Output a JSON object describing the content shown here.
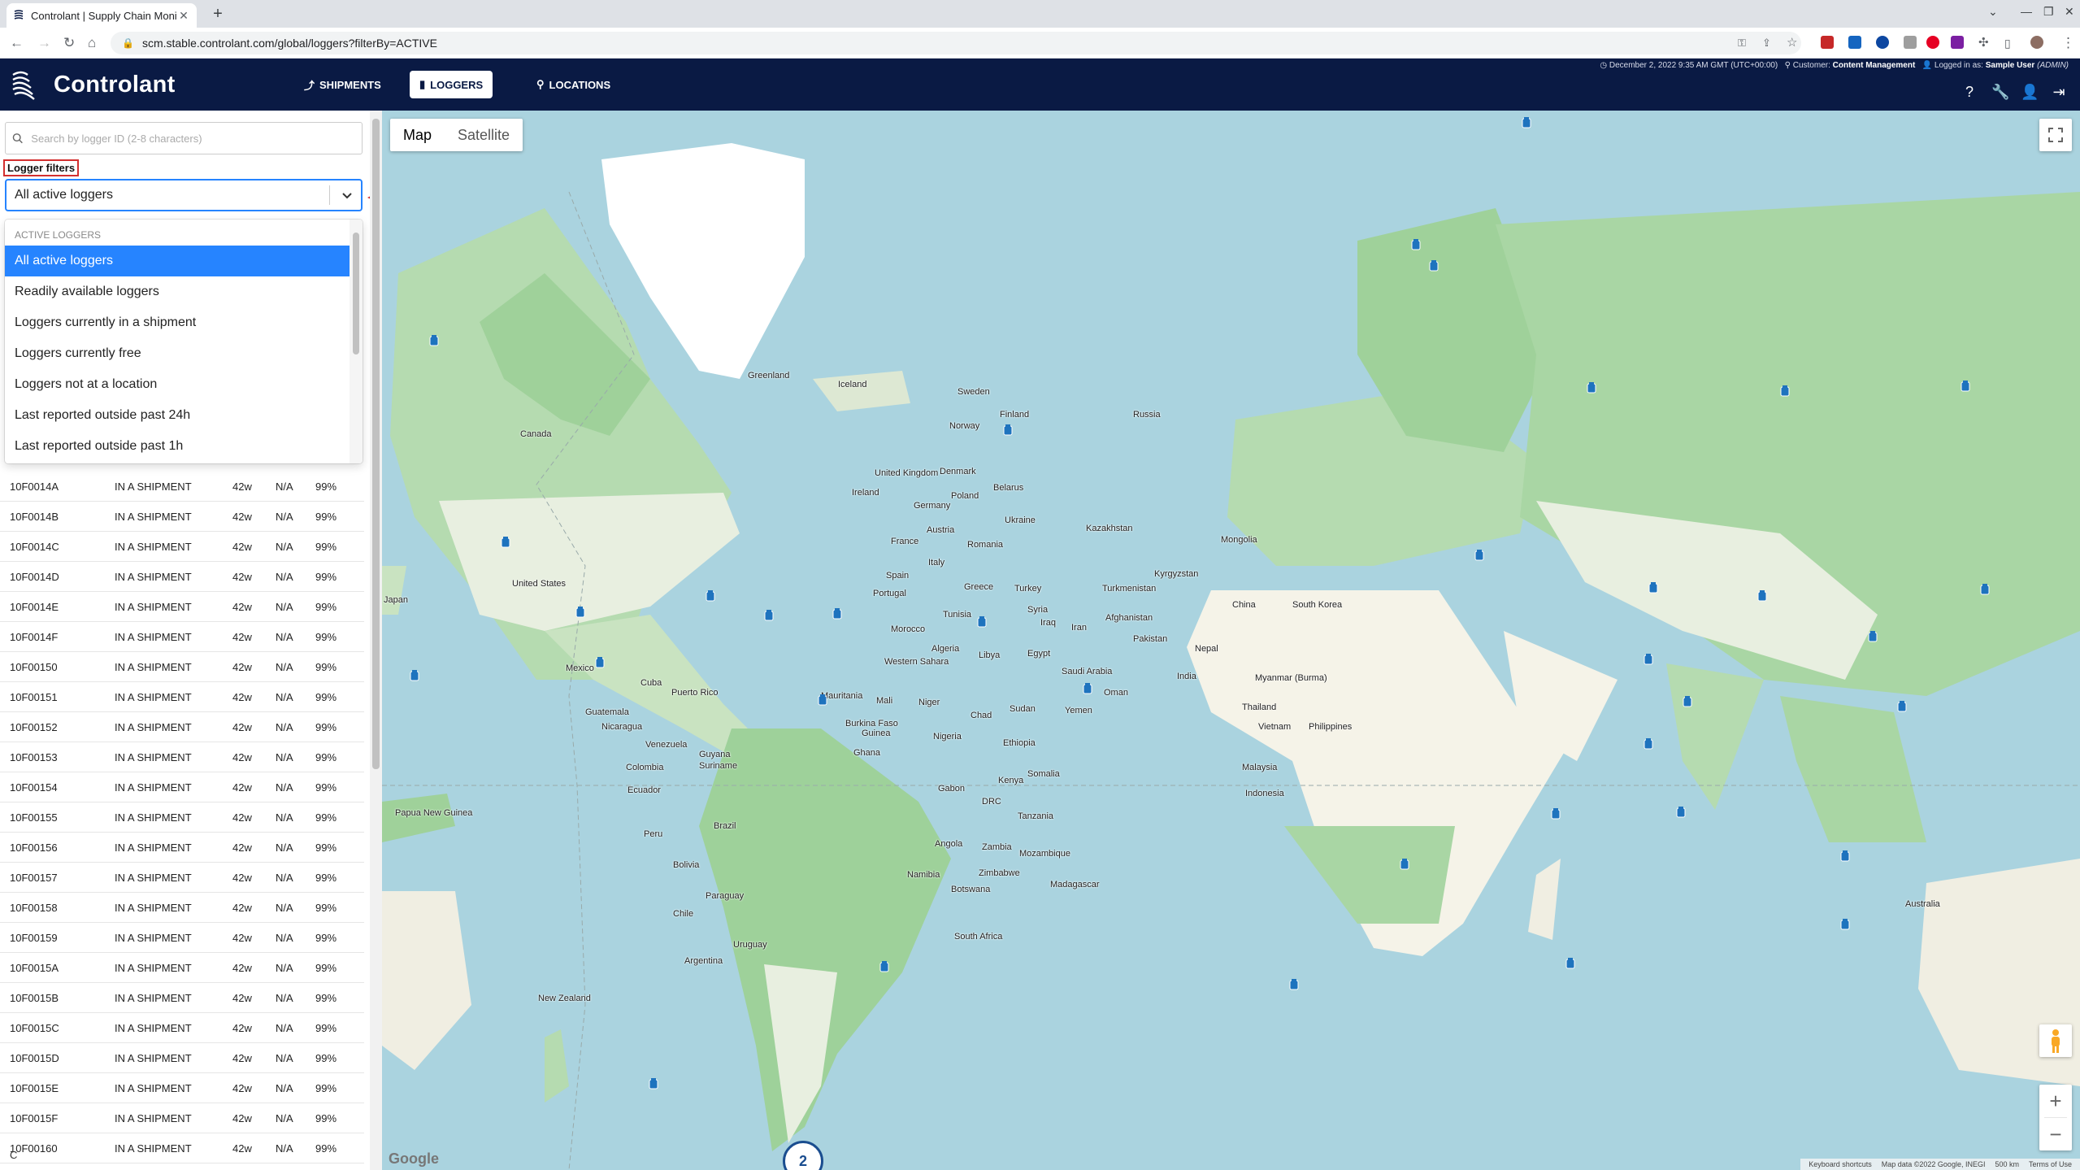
{
  "browser": {
    "tab_title": "Controlant | Supply Chain Monit...",
    "tab_close": "✕",
    "new_tab": "+",
    "url": "scm.stable.controlant.com/global/loggers?filterBy=ACTIVE",
    "window_controls": [
      "⌄",
      "—",
      "❐",
      "✕"
    ]
  },
  "app": {
    "brand": "Controlant",
    "nav": [
      {
        "label": "SHIPMENTS",
        "icon": "route-icon"
      },
      {
        "label": "LOGGERS",
        "icon": "logger-icon"
      },
      {
        "label": "LOCATIONS",
        "icon": "location-pin-icon"
      }
    ],
    "status": {
      "datetime": "December 2, 2022 9:35 AM GMT (UTC+00:00)",
      "customer_label": "Customer:",
      "customer": "Content Management",
      "logged_in_label": "Logged in as:",
      "user": "Sample User",
      "role": "(ADMIN)"
    }
  },
  "sidebar": {
    "search_placeholder": "Search by logger ID (2-8 characters)",
    "filter_label": "Logger filters",
    "selected_filter": "All active loggers",
    "dropdown_group": "ACTIVE LOGGERS",
    "options": [
      "All active loggers",
      "Readily available loggers",
      "Loggers currently in a shipment",
      "Loggers currently free",
      "Loggers not at a location",
      "Last reported outside past 24h",
      "Last reported outside past 1h"
    ],
    "rows": [
      {
        "id": "10F0014A",
        "status": "IN A SHIPMENT",
        "age": "42w",
        "na": "N/A",
        "battery": "99%"
      },
      {
        "id": "10F0014B",
        "status": "IN A SHIPMENT",
        "age": "42w",
        "na": "N/A",
        "battery": "99%"
      },
      {
        "id": "10F0014C",
        "status": "IN A SHIPMENT",
        "age": "42w",
        "na": "N/A",
        "battery": "99%"
      },
      {
        "id": "10F0014D",
        "status": "IN A SHIPMENT",
        "age": "42w",
        "na": "N/A",
        "battery": "99%"
      },
      {
        "id": "10F0014E",
        "status": "IN A SHIPMENT",
        "age": "42w",
        "na": "N/A",
        "battery": "99%"
      },
      {
        "id": "10F0014F",
        "status": "IN A SHIPMENT",
        "age": "42w",
        "na": "N/A",
        "battery": "99%"
      },
      {
        "id": "10F00150",
        "status": "IN A SHIPMENT",
        "age": "42w",
        "na": "N/A",
        "battery": "99%"
      },
      {
        "id": "10F00151",
        "status": "IN A SHIPMENT",
        "age": "42w",
        "na": "N/A",
        "battery": "99%"
      },
      {
        "id": "10F00152",
        "status": "IN A SHIPMENT",
        "age": "42w",
        "na": "N/A",
        "battery": "99%"
      },
      {
        "id": "10F00153",
        "status": "IN A SHIPMENT",
        "age": "42w",
        "na": "N/A",
        "battery": "99%"
      },
      {
        "id": "10F00154",
        "status": "IN A SHIPMENT",
        "age": "42w",
        "na": "N/A",
        "battery": "99%"
      },
      {
        "id": "10F00155",
        "status": "IN A SHIPMENT",
        "age": "42w",
        "na": "N/A",
        "battery": "99%"
      },
      {
        "id": "10F00156",
        "status": "IN A SHIPMENT",
        "age": "42w",
        "na": "N/A",
        "battery": "99%"
      },
      {
        "id": "10F00157",
        "status": "IN A SHIPMENT",
        "age": "42w",
        "na": "N/A",
        "battery": "99%"
      },
      {
        "id": "10F00158",
        "status": "IN A SHIPMENT",
        "age": "42w",
        "na": "N/A",
        "battery": "99%"
      },
      {
        "id": "10F00159",
        "status": "IN A SHIPMENT",
        "age": "42w",
        "na": "N/A",
        "battery": "99%"
      },
      {
        "id": "10F0015A",
        "status": "IN A SHIPMENT",
        "age": "42w",
        "na": "N/A",
        "battery": "99%"
      },
      {
        "id": "10F0015B",
        "status": "IN A SHIPMENT",
        "age": "42w",
        "na": "N/A",
        "battery": "99%"
      },
      {
        "id": "10F0015C",
        "status": "IN A SHIPMENT",
        "age": "42w",
        "na": "N/A",
        "battery": "99%"
      },
      {
        "id": "10F0015D",
        "status": "IN A SHIPMENT",
        "age": "42w",
        "na": "N/A",
        "battery": "99%"
      },
      {
        "id": "10F0015E",
        "status": "IN A SHIPMENT",
        "age": "42w",
        "na": "N/A",
        "battery": "99%"
      },
      {
        "id": "10F0015F",
        "status": "IN A SHIPMENT",
        "age": "42w",
        "na": "N/A",
        "battery": "99%"
      },
      {
        "id": "10F00160",
        "status": "IN A SHIPMENT",
        "age": "42w",
        "na": "N/A",
        "battery": "99%"
      }
    ]
  },
  "map": {
    "type_buttons": {
      "map": "Map",
      "satellite": "Satellite"
    },
    "cluster_count": "2",
    "google": "Google",
    "attribution": {
      "shortcuts": "Keyboard shortcuts",
      "data": "Map data ©2022 Google, INEGI",
      "scale": "500 km",
      "terms": "Terms of Use"
    },
    "zoom_in": "+",
    "zoom_out": "−",
    "labels": [
      "Greenland",
      "Iceland",
      "Sweden",
      "Finland",
      "Norway",
      "Russia",
      "Canada",
      "United Kingdom",
      "Ireland",
      "Denmark",
      "Poland",
      "Belarus",
      "Germany",
      "Ukraine",
      "France",
      "Austria",
      "Romania",
      "Kazakhstan",
      "Mongolia",
      "Spain",
      "Italy",
      "Portugal",
      "Greece",
      "Turkey",
      "Kyrgyzstan",
      "Turkmenistan",
      "China",
      "South Korea",
      "Japan",
      "United States",
      "Tunisia",
      "Syria",
      "Iraq",
      "Afghanistan",
      "Iran",
      "Morocco",
      "Pakistan",
      "Algeria",
      "Libya",
      "Egypt",
      "Nepal",
      "Western Sahara",
      "Saudi Arabia",
      "India",
      "Myanmar (Burma)",
      "Mexico",
      "Cuba",
      "Puerto Rico",
      "Mauritania",
      "Mali",
      "Niger",
      "Chad",
      "Sudan",
      "Oman",
      "Yemen",
      "Thailand",
      "Vietnam",
      "Philippines",
      "Guatemala",
      "Nicaragua",
      "Burkina Faso",
      "Guinea",
      "Nigeria",
      "Ethiopia",
      "Venezuela",
      "Guyana",
      "Suriname",
      "Ghana",
      "Colombia",
      "Somalia",
      "Malaysia",
      "Kenya",
      "Ecuador",
      "Gabon",
      "DRC",
      "Papua New Guinea",
      "Indonesia",
      "Peru",
      "Brazil",
      "Tanzania",
      "Bolivia",
      "Angola",
      "Zambia",
      "Mozambique",
      "Paraguay",
      "Namibia",
      "Zimbabwe",
      "Botswana",
      "Madagascar",
      "Chile",
      "South Africa",
      "Australia",
      "Argentina",
      "Uruguay",
      "New Zealand"
    ]
  }
}
